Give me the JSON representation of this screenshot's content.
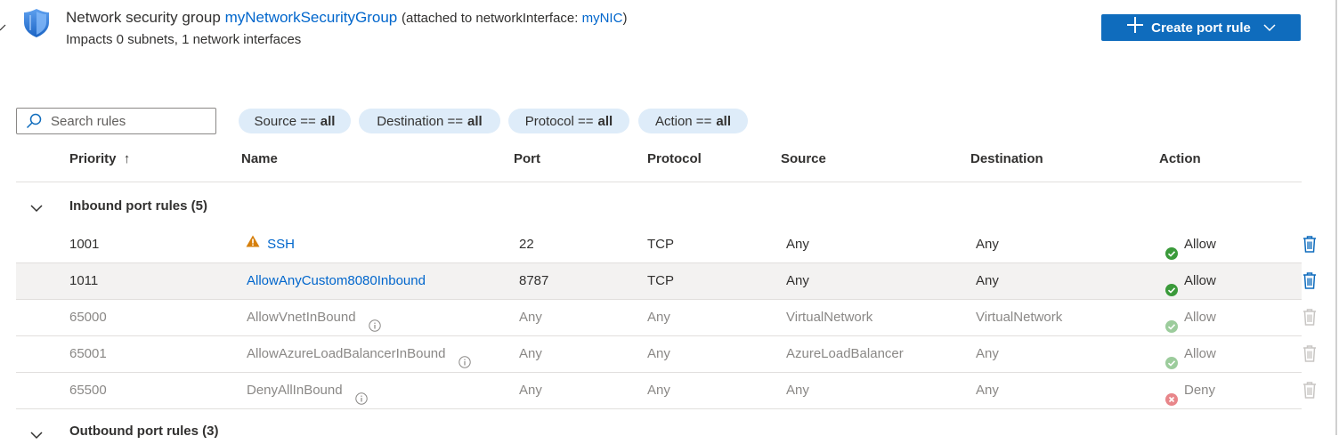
{
  "header": {
    "title_prefix": "Network security group",
    "nsg_name": "myNetworkSecurityGroup",
    "attached_prefix": "(attached to networkInterface:",
    "nic_name": "myNIC",
    "attached_suffix": ")",
    "subtitle": "Impacts 0 subnets, 1 network interfaces",
    "create_button_label": "Create port rule",
    "icons": {
      "resource": "shield-icon",
      "add": "plus-icon",
      "dropdown": "chevron-down-icon"
    }
  },
  "filters": {
    "search_placeholder": "Search rules",
    "search_value": "",
    "pills": [
      {
        "key": "Source ==",
        "value": "all"
      },
      {
        "key": "Destination ==",
        "value": "all"
      },
      {
        "key": "Protocol ==",
        "value": "all"
      },
      {
        "key": "Action ==",
        "value": "all"
      }
    ]
  },
  "columns": {
    "priority": "Priority",
    "sort_indicator": "↑",
    "name": "Name",
    "port": "Port",
    "protocol": "Protocol",
    "source": "Source",
    "destination": "Destination",
    "action": "Action"
  },
  "inbound": {
    "label": "Inbound port rules (5)",
    "rules": [
      {
        "priority": "1001",
        "name": "SSH",
        "port": "22",
        "protocol": "TCP",
        "source": "Any",
        "destination": "Any",
        "action": "Allow"
      },
      {
        "priority": "1011",
        "name": "AllowAnyCustom8080Inbound",
        "port": "8787",
        "protocol": "TCP",
        "source": "Any",
        "destination": "Any",
        "action": "Allow"
      },
      {
        "priority": "65000",
        "name": "AllowVnetInBound",
        "port": "Any",
        "protocol": "Any",
        "source": "VirtualNetwork",
        "destination": "VirtualNetwork",
        "action": "Allow"
      },
      {
        "priority": "65001",
        "name": "AllowAzureLoadBalancerInBound",
        "port": "Any",
        "protocol": "Any",
        "source": "AzureLoadBalancer",
        "destination": "Any",
        "action": "Allow"
      },
      {
        "priority": "65500",
        "name": "DenyAllInBound",
        "port": "Any",
        "protocol": "Any",
        "source": "Any",
        "destination": "Any",
        "action": "Deny"
      }
    ]
  },
  "outbound": {
    "label": "Outbound port rules (3)"
  },
  "colors": {
    "accent": "#0f6cbd",
    "link": "#0066cc",
    "allow": "#3a9a3a",
    "deny": "#d13438",
    "warning": "#d67f0b",
    "pill_bg": "#deecf9",
    "selected_row": "#f3f2f1"
  }
}
